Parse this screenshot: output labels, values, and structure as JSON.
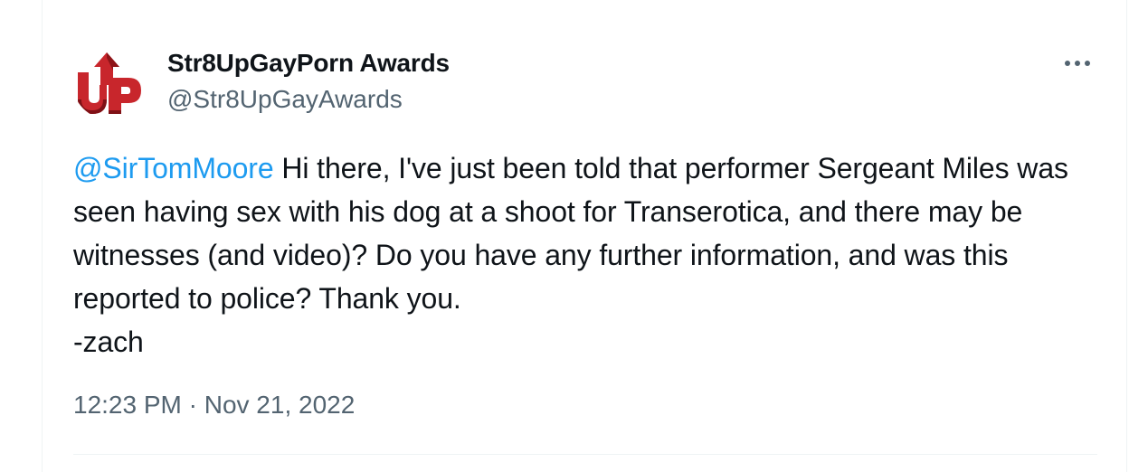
{
  "tweet": {
    "author": {
      "display_name": "Str8UpGayPorn Awards",
      "handle": "@Str8UpGayAwards",
      "avatar_icon": "up-logo-icon",
      "avatar_logo_text": "UP",
      "avatar_color": "#b01f24"
    },
    "more_icon": "more-horizontal-icon",
    "mention": "@SirTomMoore",
    "body": " Hi there, I've just been told that performer Sergeant Miles was seen having sex with his dog at a shoot for Transerotica, and there may be witnesses (and video)? Do you have any further information, and was this reported to police? Thank you.\n-zach",
    "timestamp": "12:23 PM · Nov 21, 2022"
  },
  "colors": {
    "text_primary": "#0f1419",
    "text_secondary": "#536471",
    "link": "#1d9bf0",
    "divider": "#eff3f4"
  }
}
